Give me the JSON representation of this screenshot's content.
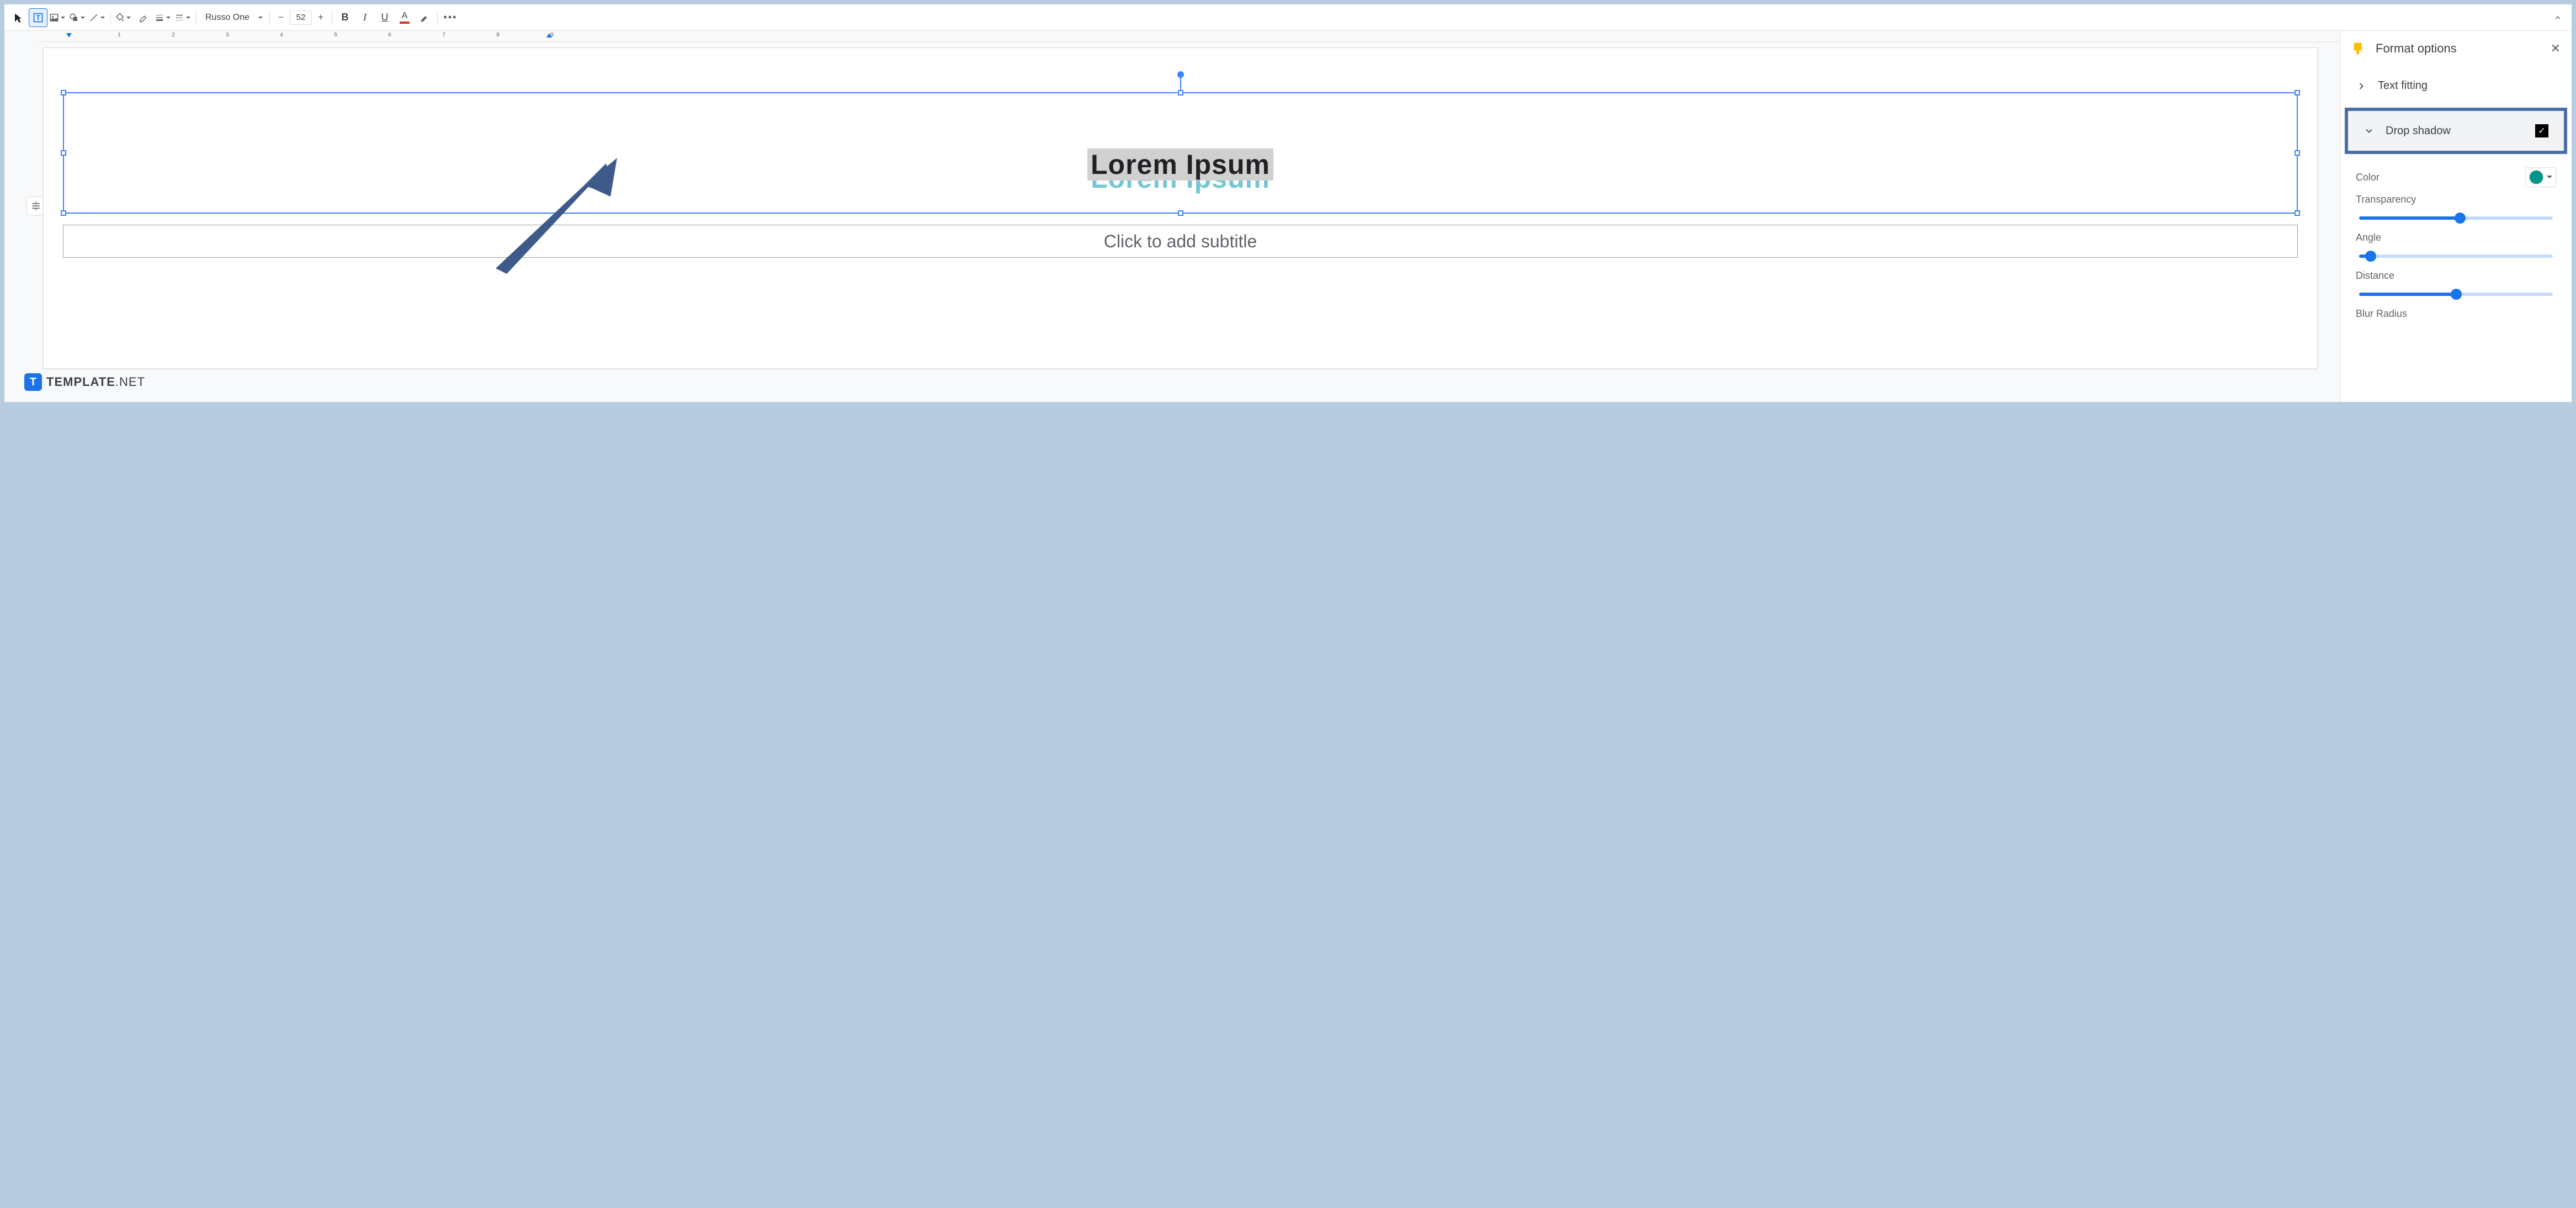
{
  "toolbar": {
    "font_name": "Russo One",
    "font_size": "52",
    "bold": "B",
    "italic": "I",
    "underline": "U",
    "text_color": "A"
  },
  "ruler": {
    "ticks": [
      "1",
      "2",
      "3",
      "4",
      "5",
      "6",
      "7",
      "8",
      "9"
    ]
  },
  "slide": {
    "title_text": "Lorem Ipsum",
    "subtitle_placeholder": "Click to add subtitle"
  },
  "sidebar": {
    "title": "Format options",
    "sections": {
      "text_fitting": "Text fitting",
      "drop_shadow": "Drop shadow"
    },
    "drop_shadow": {
      "color_label": "Color",
      "color_value": "#009688",
      "transparency_label": "Transparency",
      "transparency_pct": 52,
      "angle_label": "Angle",
      "angle_pct": 6,
      "distance_label": "Distance",
      "distance_pct": 50,
      "blur_label": "Blur Radius"
    }
  },
  "watermark": {
    "logo": "T",
    "brand": "TEMPLATE",
    "suffix": ".NET"
  }
}
